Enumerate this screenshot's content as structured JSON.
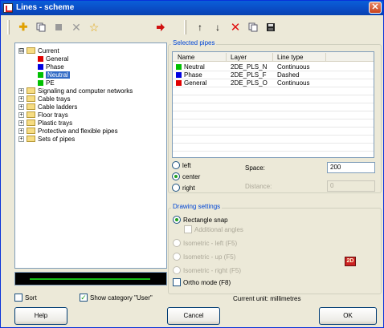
{
  "window": {
    "title": "Lines - scheme",
    "close_label": "✕"
  },
  "toolbar": {
    "left_icons": [
      "plus-icon",
      "copy-icon",
      "square-icon",
      "x-icon",
      "star-icon"
    ],
    "arrow_icon": "arrow-right-icon",
    "right_icons": [
      "move-up-icon",
      "move-down-icon",
      "delete-icon",
      "copy-icon",
      "save-icon"
    ]
  },
  "tree": {
    "items": [
      {
        "label": "Current",
        "pm": "⊟"
      },
      {
        "label": "General",
        "color": "#e00000"
      },
      {
        "label": "Phase",
        "color": "#0000e0"
      },
      {
        "label": "Neutral",
        "color": "#00c000"
      },
      {
        "label": "PE",
        "color": "#00c000"
      },
      {
        "label": "Signaling and computer networks",
        "pm": "+"
      },
      {
        "label": "Cable trays",
        "pm": "+"
      },
      {
        "label": "Cable ladders",
        "pm": "+"
      },
      {
        "label": "Floor trays",
        "pm": "+"
      },
      {
        "label": "Plastic trays",
        "pm": "+"
      },
      {
        "label": "Protective and flexible pipes",
        "pm": "+"
      },
      {
        "label": "Sets of pipes",
        "pm": "+"
      }
    ]
  },
  "options": {
    "sort_label": "Sort",
    "show_category_label": "Show category \"User\"",
    "current_unit": "Current unit: millimetres"
  },
  "selected_pipes": {
    "title": "Selected pipes",
    "columns": [
      "Name",
      "Layer",
      "Line type"
    ],
    "rows": [
      {
        "name": "Neutral",
        "color": "#00c000",
        "layer": "2DE_PLS_N",
        "line_type": "Continuous"
      },
      {
        "name": "Phase",
        "color": "#0000e0",
        "layer": "2DE_PLS_F",
        "line_type": "Dashed"
      },
      {
        "name": "General",
        "color": "#e00000",
        "layer": "2DE_PLS_O",
        "line_type": "Continuous"
      }
    ]
  },
  "alignment": {
    "left": "left",
    "center": "center",
    "right": "right",
    "space_label": "Space:",
    "space_value": "200",
    "distance_label": "Distance:",
    "distance_value": "0"
  },
  "drawing_settings": {
    "title": "Drawing settings",
    "rectangle_snap": "Rectangle snap",
    "additional_angles": "Additional angles",
    "iso_left": "Isometric - left (F5)",
    "iso_up": "Isometric - up (F5)",
    "iso_right": "Isometric - right (F5)",
    "ortho": "Ortho mode (F8)",
    "badge": "2D"
  },
  "buttons": {
    "help": "Help",
    "cancel": "Cancel",
    "ok": "OK"
  }
}
